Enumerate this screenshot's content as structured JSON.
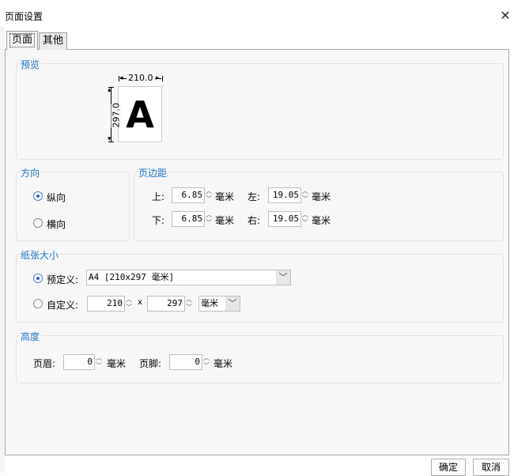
{
  "window": {
    "title": "页面设置",
    "close_glyph": "✕"
  },
  "tabs": [
    {
      "label": "页面"
    },
    {
      "label": "其他"
    }
  ],
  "preview": {
    "title": "预览",
    "width_label": "210.0",
    "height_label": "297.0",
    "letter": "A"
  },
  "orientation": {
    "title": "方向",
    "portrait": "纵向",
    "landscape": "横向",
    "selected": "portrait"
  },
  "margins": {
    "title": "页边距",
    "top_label": "上:",
    "top_value": "6.85",
    "bottom_label": "下:",
    "bottom_value": "6.85",
    "left_label": "左:",
    "left_value": "19.05",
    "right_label": "右:",
    "right_value": "19.05",
    "unit": "毫米"
  },
  "paper": {
    "title": "纸张大小",
    "predefined_label": "预定义:",
    "predefined_value": "A4 [210x297 毫米]",
    "custom_label": "自定义:",
    "custom_width": "210",
    "custom_height": "297",
    "times": "x",
    "custom_unit": "毫米",
    "selected": "predefined"
  },
  "height": {
    "title": "高度",
    "header_label": "页眉:",
    "header_value": "0",
    "footer_label": "页脚:",
    "footer_value": "0",
    "unit": "毫米"
  },
  "buttons": {
    "ok": "确定",
    "cancel": "取消"
  },
  "icons": {
    "close": "close-icon",
    "spin_up": "chevron-up-icon",
    "spin_down": "chevron-down-icon",
    "dropdown": "chevron-down-icon"
  },
  "colors": {
    "group_title": "#1a73c9",
    "radio_selected": "#2a62c9"
  }
}
